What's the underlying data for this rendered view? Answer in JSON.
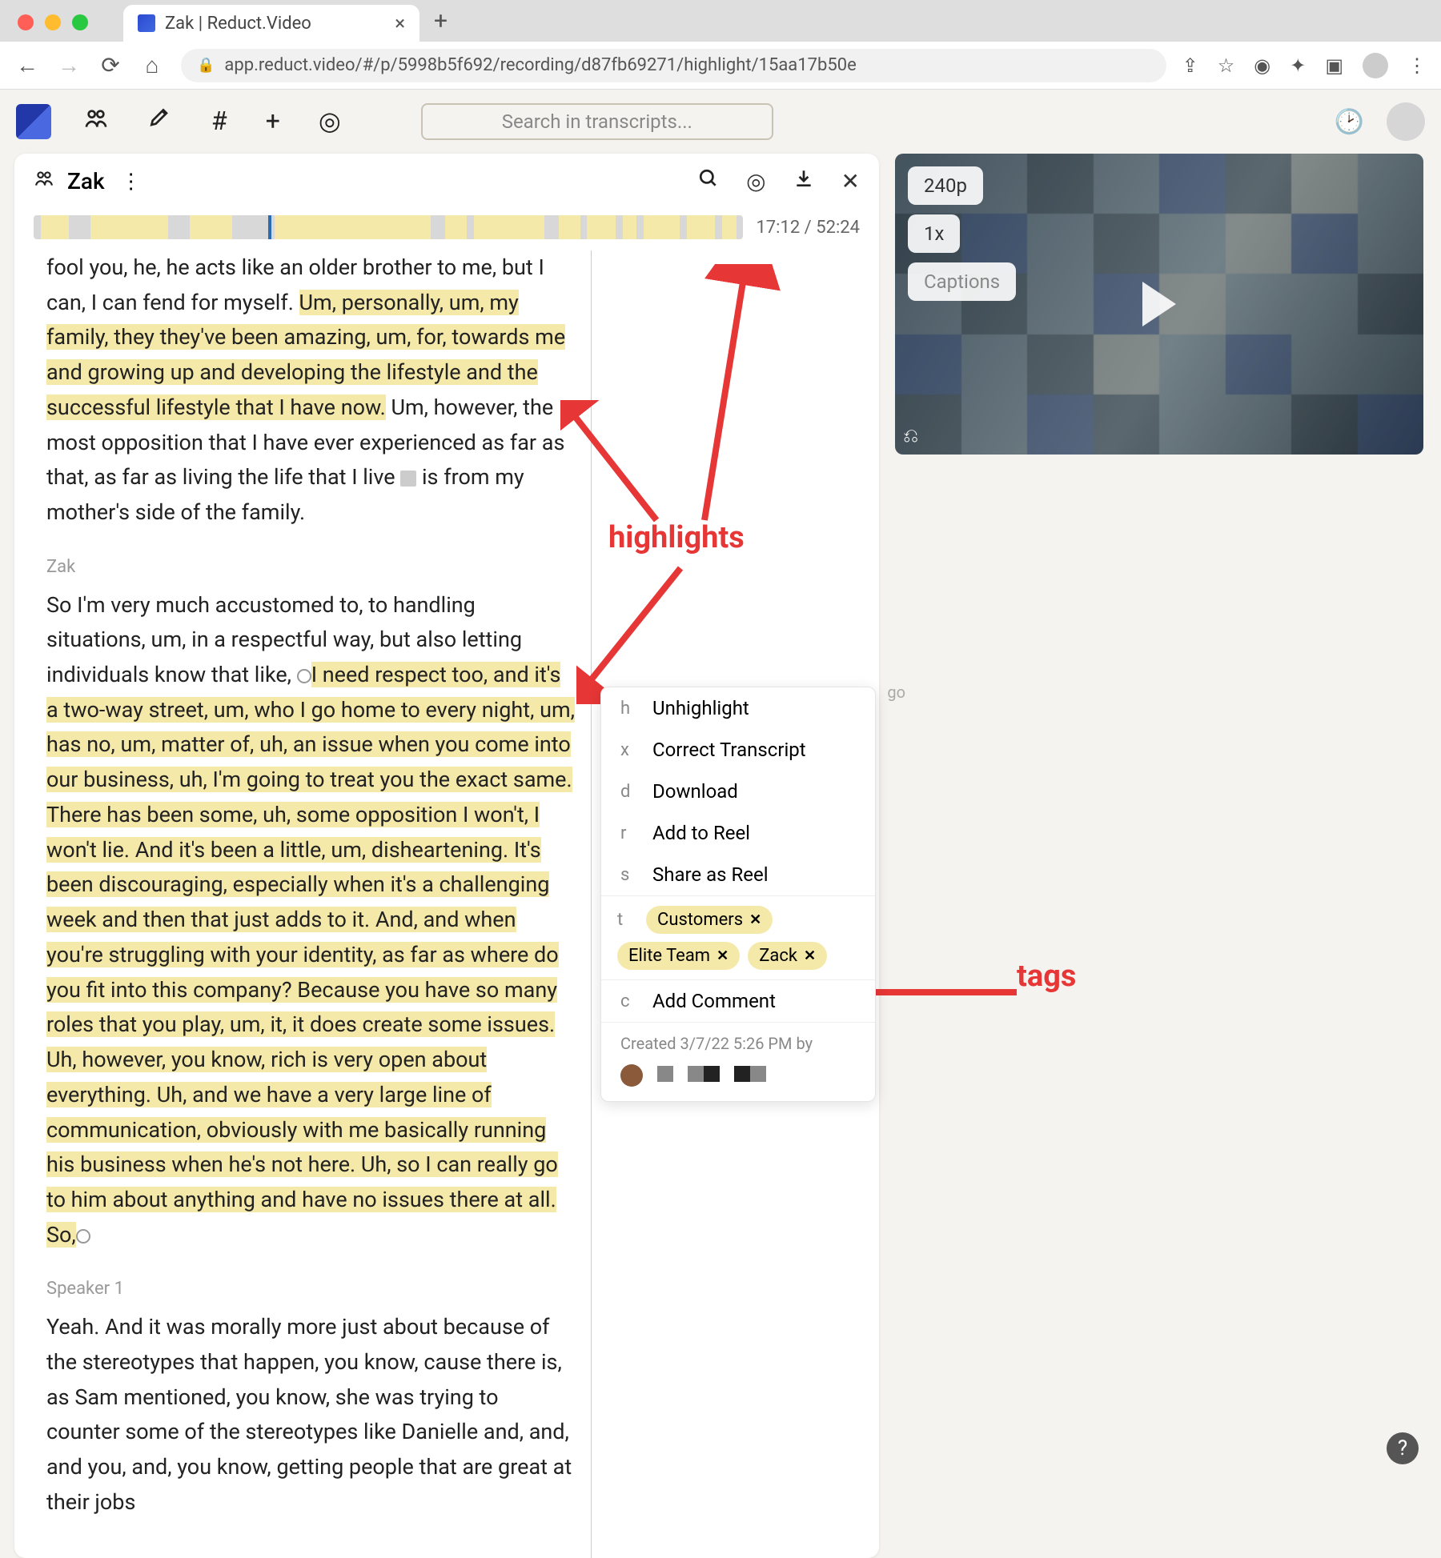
{
  "browser": {
    "tab_title": "Zak | Reduct.Video",
    "url": "app.reduct.video/#/p/5998b5f692/recording/d87fb69271/highlight/15aa17b50e"
  },
  "app": {
    "search_placeholder": "Search in transcripts..."
  },
  "panel": {
    "name": "Zak",
    "time": "17:12 / 52:24"
  },
  "transcript": {
    "p1": {
      "pre": "fool you, he, he acts like an older brother to me, but I can, I can fend for myself. ",
      "hl": "Um, personally, um, my family, they they've been amazing, um, for, towards me and growing up and developing the lifestyle and the successful lifestyle that I have now.",
      "post1": " Um, however, the most opposition that I have ever experienced as far as that, as far as living the life that I live ",
      "post2": " is from my mother's side of the family."
    },
    "s2": "Zak",
    "p2": {
      "pre": "So I'm very much accustomed to, to handling situations, um, in a respectful way, but also letting individuals know that like, ",
      "hl": "I need respect too, and it's a two-way street, um, who I go home to every night, um, has no, um, matter of, uh, an issue when you come into our business, uh, I'm going to treat you the exact same. There has been some, uh, some opposition I won't, I won't lie. And it's been a little, um, disheartening. It's been discouraging, especially when it's a challenging week and then that just adds to it. And, and when you're struggling with your identity, as far as where do you fit into this company? Because you have so many roles that you play, um, it, it does create some issues. Uh, however, you know, rich is very open about everything. Uh, and we have a very large line of communication, obviously with me basically running his business when he's not here. Uh, so I can really go to him about anything and have no issues there at all. So,"
    },
    "s3": "Speaker 1",
    "p3": "Yeah. And it was morally more just about because of the stereotypes that happen, you know, cause there is, as Sam mentioned, you know, she was trying to counter some of the stereotypes like Danielle and, and, and you, and, you know, getting people that are great at their jobs"
  },
  "ctx": {
    "ago": "go",
    "items": [
      {
        "k": "h",
        "label": "Unhighlight"
      },
      {
        "k": "x",
        "label": "Correct Transcript"
      },
      {
        "k": "d",
        "label": "Download"
      },
      {
        "k": "r",
        "label": "Add to Reel"
      },
      {
        "k": "s",
        "label": "Share as Reel"
      }
    ],
    "tags_key": "t",
    "tags": [
      "Customers",
      "Elite Team",
      "Zack"
    ],
    "comment_key": "c",
    "comment_label": "Add Comment",
    "created": "Created 3/7/22 5:26 PM by"
  },
  "video": {
    "quality": "240p",
    "speed": "1x",
    "captions": "Captions"
  },
  "annotations": {
    "highlights": "highlights",
    "tags": "tags"
  },
  "timeline_highlights": [
    {
      "l": 1,
      "w": 4
    },
    {
      "l": 8,
      "w": 11
    },
    {
      "l": 22,
      "w": 6
    },
    {
      "l": 34,
      "w": 22
    },
    {
      "l": 58,
      "w": 3
    },
    {
      "l": 62,
      "w": 10
    },
    {
      "l": 74,
      "w": 3
    },
    {
      "l": 78,
      "w": 4
    },
    {
      "l": 83,
      "w": 2
    },
    {
      "l": 86,
      "w": 5
    },
    {
      "l": 92,
      "w": 4
    },
    {
      "l": 97,
      "w": 2
    }
  ],
  "playhead": 33
}
